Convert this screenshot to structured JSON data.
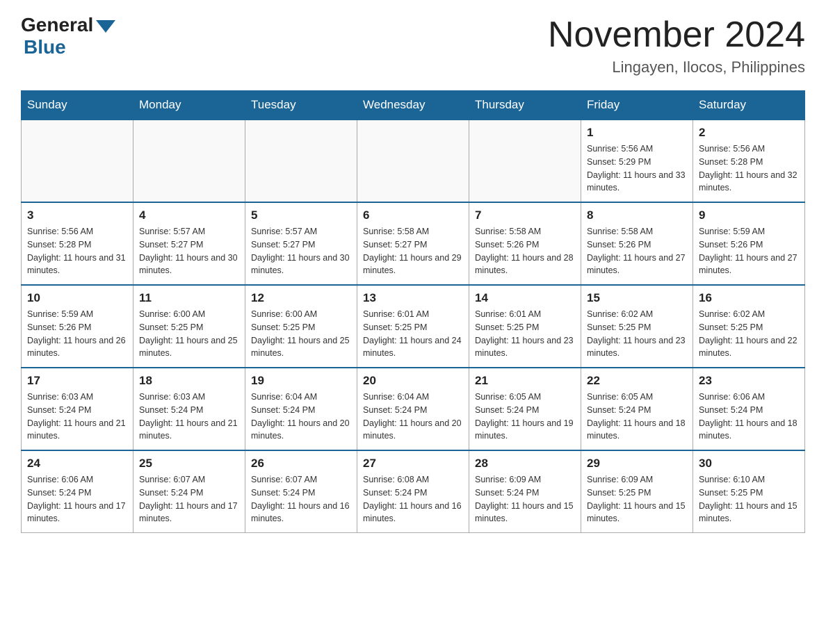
{
  "header": {
    "logo_general": "General",
    "logo_blue": "Blue",
    "month_title": "November 2024",
    "subtitle": "Lingayen, Ilocos, Philippines"
  },
  "weekdays": [
    "Sunday",
    "Monday",
    "Tuesday",
    "Wednesday",
    "Thursday",
    "Friday",
    "Saturday"
  ],
  "weeks": [
    [
      {
        "day": "",
        "sunrise": "",
        "sunset": "",
        "daylight": ""
      },
      {
        "day": "",
        "sunrise": "",
        "sunset": "",
        "daylight": ""
      },
      {
        "day": "",
        "sunrise": "",
        "sunset": "",
        "daylight": ""
      },
      {
        "day": "",
        "sunrise": "",
        "sunset": "",
        "daylight": ""
      },
      {
        "day": "",
        "sunrise": "",
        "sunset": "",
        "daylight": ""
      },
      {
        "day": "1",
        "sunrise": "Sunrise: 5:56 AM",
        "sunset": "Sunset: 5:29 PM",
        "daylight": "Daylight: 11 hours and 33 minutes."
      },
      {
        "day": "2",
        "sunrise": "Sunrise: 5:56 AM",
        "sunset": "Sunset: 5:28 PM",
        "daylight": "Daylight: 11 hours and 32 minutes."
      }
    ],
    [
      {
        "day": "3",
        "sunrise": "Sunrise: 5:56 AM",
        "sunset": "Sunset: 5:28 PM",
        "daylight": "Daylight: 11 hours and 31 minutes."
      },
      {
        "day": "4",
        "sunrise": "Sunrise: 5:57 AM",
        "sunset": "Sunset: 5:27 PM",
        "daylight": "Daylight: 11 hours and 30 minutes."
      },
      {
        "day": "5",
        "sunrise": "Sunrise: 5:57 AM",
        "sunset": "Sunset: 5:27 PM",
        "daylight": "Daylight: 11 hours and 30 minutes."
      },
      {
        "day": "6",
        "sunrise": "Sunrise: 5:58 AM",
        "sunset": "Sunset: 5:27 PM",
        "daylight": "Daylight: 11 hours and 29 minutes."
      },
      {
        "day": "7",
        "sunrise": "Sunrise: 5:58 AM",
        "sunset": "Sunset: 5:26 PM",
        "daylight": "Daylight: 11 hours and 28 minutes."
      },
      {
        "day": "8",
        "sunrise": "Sunrise: 5:58 AM",
        "sunset": "Sunset: 5:26 PM",
        "daylight": "Daylight: 11 hours and 27 minutes."
      },
      {
        "day": "9",
        "sunrise": "Sunrise: 5:59 AM",
        "sunset": "Sunset: 5:26 PM",
        "daylight": "Daylight: 11 hours and 27 minutes."
      }
    ],
    [
      {
        "day": "10",
        "sunrise": "Sunrise: 5:59 AM",
        "sunset": "Sunset: 5:26 PM",
        "daylight": "Daylight: 11 hours and 26 minutes."
      },
      {
        "day": "11",
        "sunrise": "Sunrise: 6:00 AM",
        "sunset": "Sunset: 5:25 PM",
        "daylight": "Daylight: 11 hours and 25 minutes."
      },
      {
        "day": "12",
        "sunrise": "Sunrise: 6:00 AM",
        "sunset": "Sunset: 5:25 PM",
        "daylight": "Daylight: 11 hours and 25 minutes."
      },
      {
        "day": "13",
        "sunrise": "Sunrise: 6:01 AM",
        "sunset": "Sunset: 5:25 PM",
        "daylight": "Daylight: 11 hours and 24 minutes."
      },
      {
        "day": "14",
        "sunrise": "Sunrise: 6:01 AM",
        "sunset": "Sunset: 5:25 PM",
        "daylight": "Daylight: 11 hours and 23 minutes."
      },
      {
        "day": "15",
        "sunrise": "Sunrise: 6:02 AM",
        "sunset": "Sunset: 5:25 PM",
        "daylight": "Daylight: 11 hours and 23 minutes."
      },
      {
        "day": "16",
        "sunrise": "Sunrise: 6:02 AM",
        "sunset": "Sunset: 5:25 PM",
        "daylight": "Daylight: 11 hours and 22 minutes."
      }
    ],
    [
      {
        "day": "17",
        "sunrise": "Sunrise: 6:03 AM",
        "sunset": "Sunset: 5:24 PM",
        "daylight": "Daylight: 11 hours and 21 minutes."
      },
      {
        "day": "18",
        "sunrise": "Sunrise: 6:03 AM",
        "sunset": "Sunset: 5:24 PM",
        "daylight": "Daylight: 11 hours and 21 minutes."
      },
      {
        "day": "19",
        "sunrise": "Sunrise: 6:04 AM",
        "sunset": "Sunset: 5:24 PM",
        "daylight": "Daylight: 11 hours and 20 minutes."
      },
      {
        "day": "20",
        "sunrise": "Sunrise: 6:04 AM",
        "sunset": "Sunset: 5:24 PM",
        "daylight": "Daylight: 11 hours and 20 minutes."
      },
      {
        "day": "21",
        "sunrise": "Sunrise: 6:05 AM",
        "sunset": "Sunset: 5:24 PM",
        "daylight": "Daylight: 11 hours and 19 minutes."
      },
      {
        "day": "22",
        "sunrise": "Sunrise: 6:05 AM",
        "sunset": "Sunset: 5:24 PM",
        "daylight": "Daylight: 11 hours and 18 minutes."
      },
      {
        "day": "23",
        "sunrise": "Sunrise: 6:06 AM",
        "sunset": "Sunset: 5:24 PM",
        "daylight": "Daylight: 11 hours and 18 minutes."
      }
    ],
    [
      {
        "day": "24",
        "sunrise": "Sunrise: 6:06 AM",
        "sunset": "Sunset: 5:24 PM",
        "daylight": "Daylight: 11 hours and 17 minutes."
      },
      {
        "day": "25",
        "sunrise": "Sunrise: 6:07 AM",
        "sunset": "Sunset: 5:24 PM",
        "daylight": "Daylight: 11 hours and 17 minutes."
      },
      {
        "day": "26",
        "sunrise": "Sunrise: 6:07 AM",
        "sunset": "Sunset: 5:24 PM",
        "daylight": "Daylight: 11 hours and 16 minutes."
      },
      {
        "day": "27",
        "sunrise": "Sunrise: 6:08 AM",
        "sunset": "Sunset: 5:24 PM",
        "daylight": "Daylight: 11 hours and 16 minutes."
      },
      {
        "day": "28",
        "sunrise": "Sunrise: 6:09 AM",
        "sunset": "Sunset: 5:24 PM",
        "daylight": "Daylight: 11 hours and 15 minutes."
      },
      {
        "day": "29",
        "sunrise": "Sunrise: 6:09 AM",
        "sunset": "Sunset: 5:25 PM",
        "daylight": "Daylight: 11 hours and 15 minutes."
      },
      {
        "day": "30",
        "sunrise": "Sunrise: 6:10 AM",
        "sunset": "Sunset: 5:25 PM",
        "daylight": "Daylight: 11 hours and 15 minutes."
      }
    ]
  ]
}
